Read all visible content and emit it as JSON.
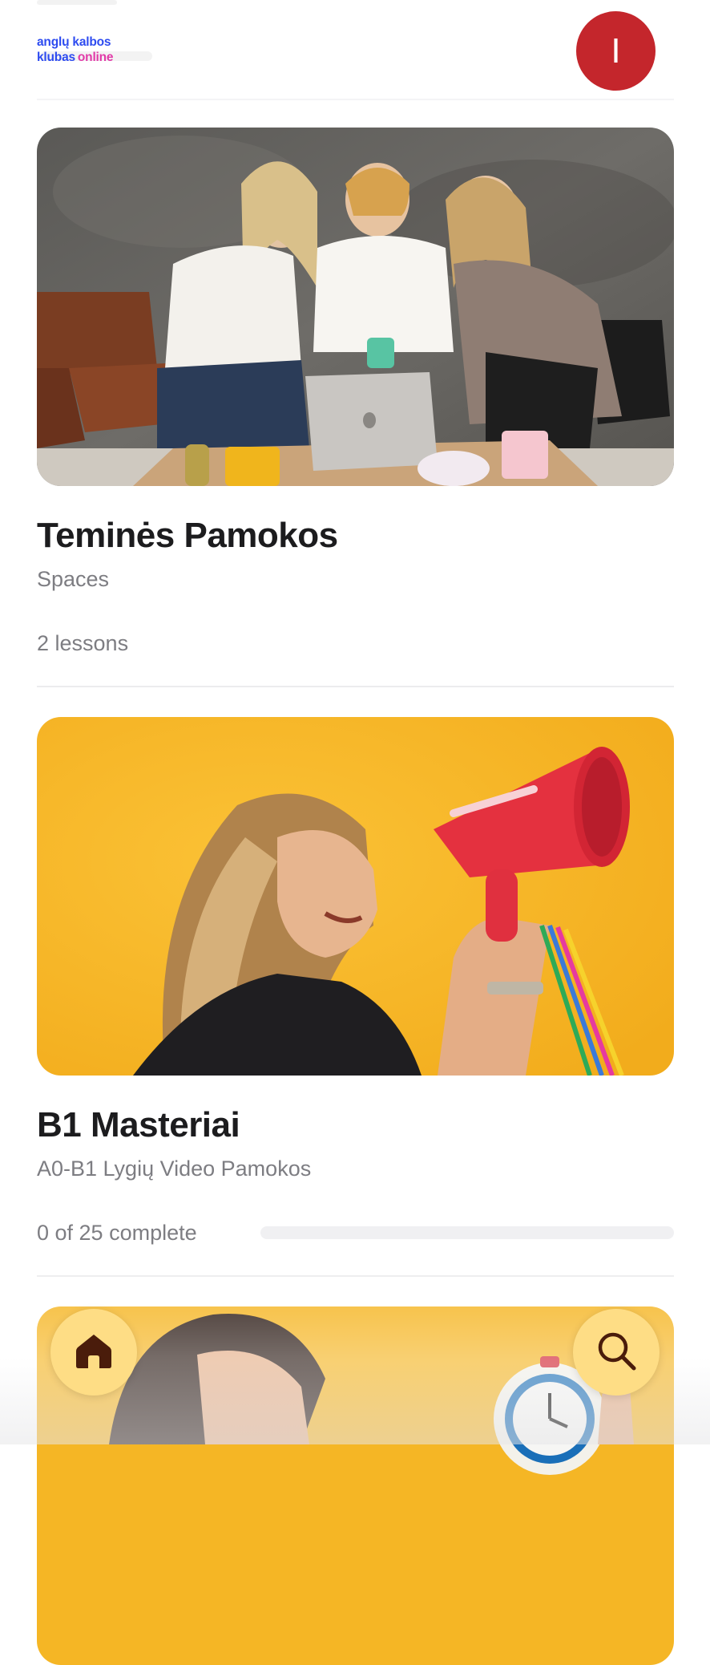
{
  "header": {
    "logo": {
      "line1": "anglų kalbos",
      "line2_part1": "klubas",
      "line2_part2": "online"
    },
    "avatar_initial": "I"
  },
  "courses": [
    {
      "title": "Teminės Pamokos",
      "subtitle": "Spaces",
      "meta": "2 lessons",
      "image": "group-at-laptop-photo"
    },
    {
      "title": "B1 Masteriai",
      "subtitle": "A0-B1 Lygių Video Pamokos",
      "meta": "0 of 25 complete",
      "progress": 0,
      "image": "woman-with-megaphone-photo"
    },
    {
      "image": "woman-with-alarm-clock-photo"
    }
  ],
  "bottom_nav": {
    "home_icon": "home-icon",
    "search_icon": "search-icon"
  },
  "colors": {
    "avatar": "#c4262c",
    "fab": "#fedd85",
    "logo_blue": "#2d4bf0",
    "logo_pink": "#e13aa8",
    "card2_bg": "#f7b82a",
    "text_secondary": "#7d7d82"
  }
}
